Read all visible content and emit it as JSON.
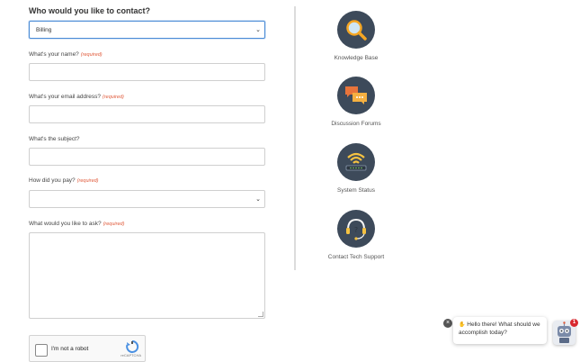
{
  "form": {
    "heading": "Who would you like to contact?",
    "contact_select": {
      "value": "Billing"
    },
    "required_tag": "(required)",
    "name_label": "What's your name?",
    "email_label": "What's your email address?",
    "subject_label": "What's the subject?",
    "pay_label": "How did you pay?",
    "pay_select": {
      "value": ""
    },
    "ask_label": "What would you like to ask?"
  },
  "captcha": {
    "label": "I'm not a robot",
    "brand": "reCAPTCHA"
  },
  "resources": [
    {
      "label": "Knowledge Base",
      "icon": "magnifier-icon"
    },
    {
      "label": "Discussion Forums",
      "icon": "chat-bubbles-icon"
    },
    {
      "label": "System Status",
      "icon": "wifi-router-icon"
    },
    {
      "label": "Contact Tech Support",
      "icon": "headset-icon"
    }
  ],
  "chat": {
    "message": "Hello there! What should we accomplish today?",
    "badge_count": "1",
    "close": "×"
  },
  "colors": {
    "icon_circle": "#3d4a5a",
    "accent_orange": "#f5a623",
    "required_red": "#e05a3a",
    "focus_blue": "#4a8bd6"
  }
}
